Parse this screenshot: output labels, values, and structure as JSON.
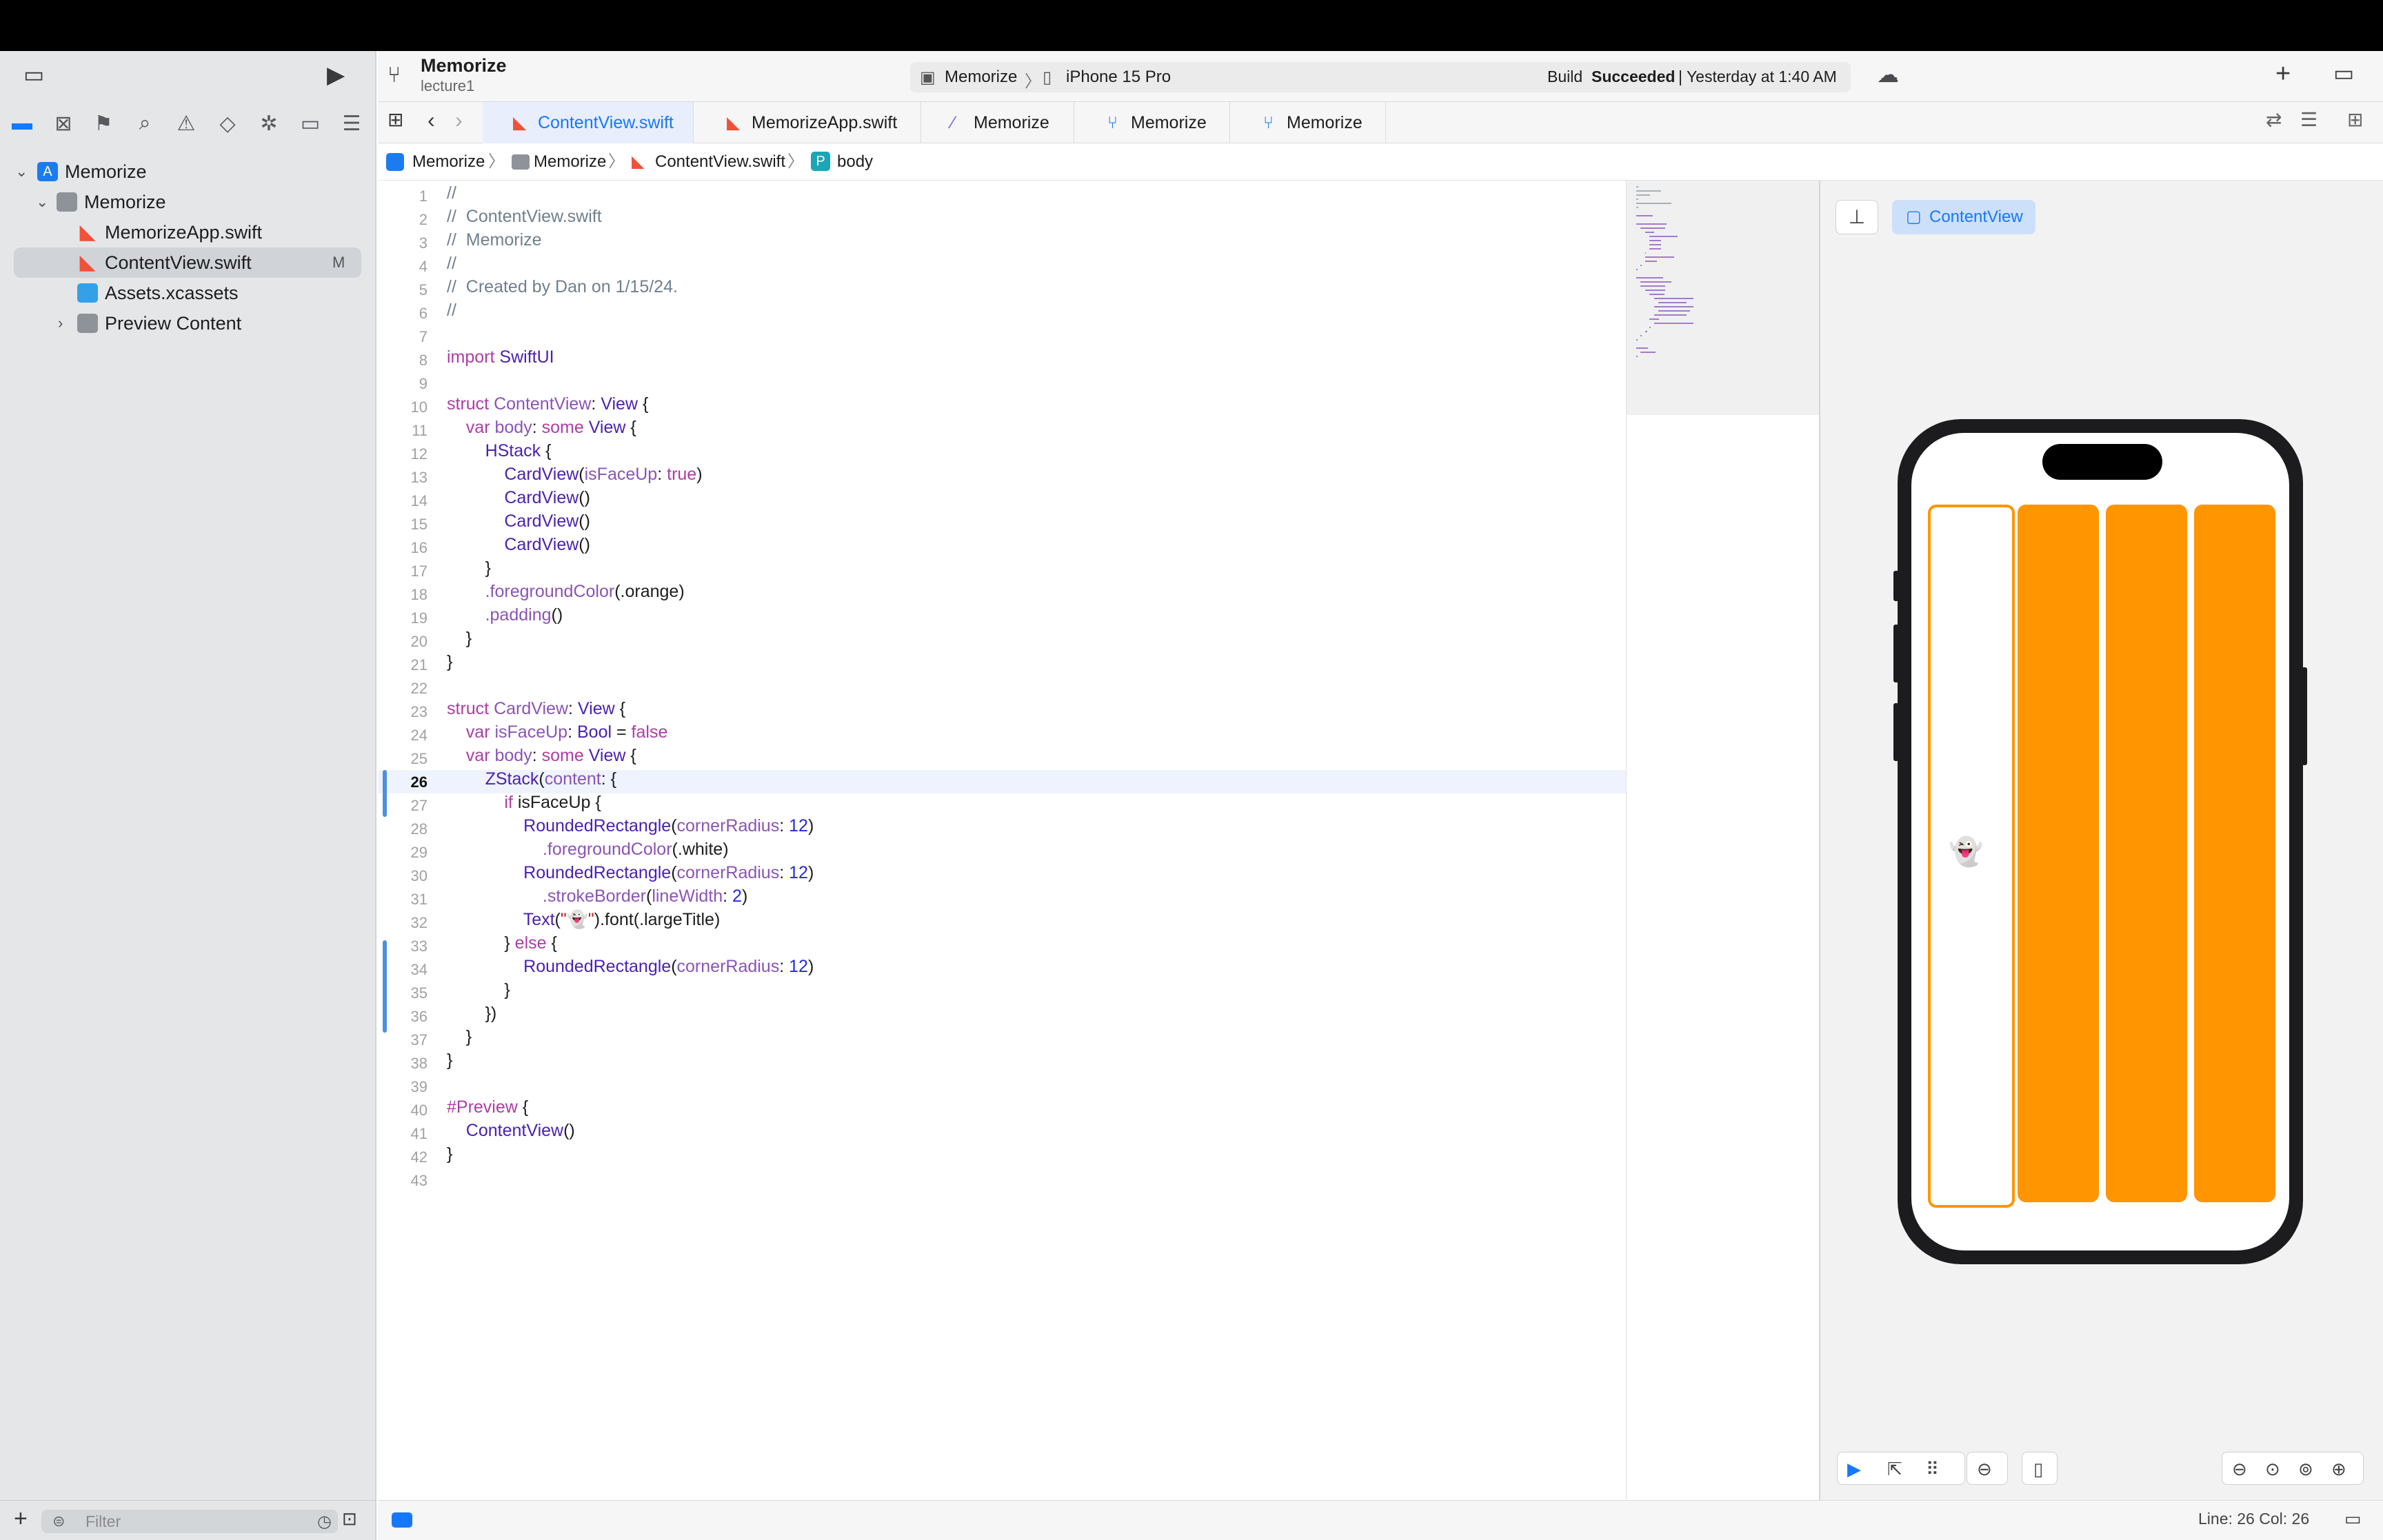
{
  "toolbar": {
    "project_name": "Memorize",
    "branch": "lecture1",
    "scheme": "Memorize",
    "device": "iPhone 15 Pro",
    "status_prefix": "Build",
    "status_strong": "Succeeded",
    "status_suffix": "| Yesterday at 1:40 AM"
  },
  "tabs": [
    {
      "label": "ContentView.swift",
      "active": true
    },
    {
      "label": "MemorizeApp.swift",
      "active": false
    },
    {
      "label": "Memorize",
      "active": false
    },
    {
      "label": "Memorize",
      "active": false
    },
    {
      "label": "Memorize",
      "active": false
    }
  ],
  "breadcrumb": [
    "Memorize",
    "Memorize",
    "ContentView.swift",
    "body"
  ],
  "navigator": {
    "items": [
      {
        "label": "Memorize",
        "kind": "project"
      },
      {
        "label": "Memorize",
        "kind": "folder"
      },
      {
        "label": "MemorizeApp.swift",
        "kind": "swift"
      },
      {
        "label": "ContentView.swift",
        "kind": "swift",
        "selected": true,
        "badge": "M"
      },
      {
        "label": "Assets.xcassets",
        "kind": "assets"
      },
      {
        "label": "Preview Content",
        "kind": "folder"
      }
    ],
    "filter_placeholder": "Filter"
  },
  "code": {
    "current_line": 26,
    "lines": [
      "//",
      "//  ContentView.swift",
      "//  Memorize",
      "//",
      "//  Created by Dan on 1/15/24.",
      "//",
      "",
      "import SwiftUI",
      "",
      "struct ContentView: View {",
      "    var body: some View {",
      "        HStack {",
      "            CardView(isFaceUp: true)",
      "            CardView()",
      "            CardView()",
      "            CardView()",
      "        }",
      "        .foregroundColor(.orange)",
      "        .padding()",
      "    }",
      "}",
      "",
      "struct CardView: View {",
      "    var isFaceUp: Bool = false",
      "    var body: some View {",
      "        ZStack(content: {",
      "            if isFaceUp {",
      "                RoundedRectangle(cornerRadius: 12)",
      "                    .foregroundColor(.white)",
      "                RoundedRectangle(cornerRadius: 12)",
      "                    .strokeBorder(lineWidth: 2)",
      "                Text(\"👻\").font(.largeTitle)",
      "            } else {",
      "                RoundedRectangle(cornerRadius: 12)",
      "            }",
      "        })",
      "    }",
      "}",
      "",
      "#Preview {",
      "    ContentView()",
      "}",
      ""
    ]
  },
  "preview": {
    "view_name": "ContentView",
    "card_emoji": "👻",
    "card_color": "#ff9500"
  },
  "statusbar": {
    "position": "Line: 26  Col: 26"
  }
}
